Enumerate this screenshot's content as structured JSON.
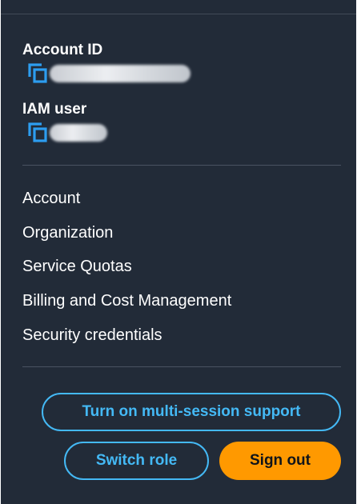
{
  "account_menu": {
    "account_id": {
      "label": "Account ID",
      "copy_icon": "copy-icon"
    },
    "iam_user": {
      "label": "IAM user",
      "copy_icon": "copy-icon"
    },
    "items": [
      {
        "label": "Account"
      },
      {
        "label": "Organization"
      },
      {
        "label": "Service Quotas"
      },
      {
        "label": "Billing and Cost Management"
      },
      {
        "label": "Security credentials"
      }
    ],
    "buttons": {
      "multi_session": "Turn on multi-session support",
      "switch_role": "Switch role",
      "sign_out": "Sign out"
    }
  },
  "colors": {
    "panel_background": "#222b38",
    "accent_blue": "#44b9f5",
    "sign_out_orange": "#ff9900",
    "text": "#ffffff"
  }
}
